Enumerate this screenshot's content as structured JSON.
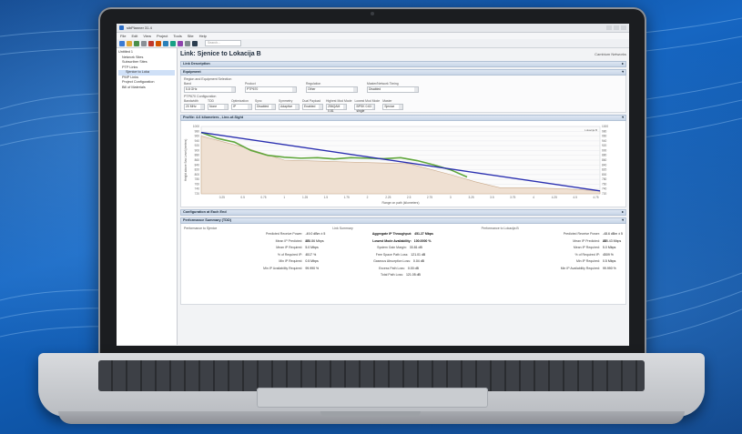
{
  "app": {
    "window_title": "sibPlanner 31.4",
    "menu": [
      "File",
      "Edit",
      "View",
      "Project",
      "Tools",
      "Site",
      "Help"
    ],
    "search_placeholder": "Search...",
    "page_title": "Link: Sjenice to Lokacija B",
    "header_link": "Cambium Networks"
  },
  "tree": [
    {
      "label": "Untitled 1",
      "selected": false
    },
    {
      "label": "Network Sites",
      "selected": false
    },
    {
      "label": "Subscriber Sites",
      "selected": false
    },
    {
      "label": "PTP Links",
      "selected": false
    },
    {
      "label": "Sjenice to Loka",
      "selected": true
    },
    {
      "label": "PMP Links",
      "selected": false
    },
    {
      "label": "Project Configuration",
      "selected": false
    },
    {
      "label": "Bill of Materials",
      "selected": false
    }
  ],
  "sections": {
    "link_description": "Link Description",
    "equipment": "Equipment",
    "profile": "Profile: 4.6 kilometers , Line-of-Sight",
    "configuration": "Configuration at Each End",
    "performance": "Performance Summary (TDD)"
  },
  "equipment": {
    "region_label": "Region and Equipment Selection",
    "fields": [
      {
        "label": "Band",
        "value": "5.8 GHz"
      },
      {
        "label": "Product",
        "value": "PTP670"
      },
      {
        "label": "Regulation",
        "value": "Other"
      },
      {
        "label": "Master/Network Timing",
        "value": "Disabled"
      }
    ],
    "ptp_label": "PTP670 Configuration",
    "config_fields": [
      {
        "label": "Bandwidth",
        "value": "20 MHz"
      },
      {
        "label": "TDD",
        "value": "None"
      },
      {
        "label": "Optimization",
        "value": "IP"
      },
      {
        "label": "Sync",
        "value": "Disabled"
      },
      {
        "label": "Symmetry",
        "value": "Adaptive"
      },
      {
        "label": "Dual Payload",
        "value": "Enabled"
      },
      {
        "label": "Highest Mod Mode",
        "value": "256QAM 0.81"
      },
      {
        "label": "Lowest Mod Mode",
        "value": "BPSK 0.63 single"
      },
      {
        "label": "Master",
        "value": "Sjenice"
      }
    ]
  },
  "chart_data": {
    "type": "line",
    "title": "",
    "xlabel": "Range on path (kilometers)",
    "ylabel": "Height above Sea Level (meters)",
    "x_ticks": [
      "0.25",
      "0.5",
      "0.75",
      "1",
      "1.25",
      "1.5",
      "1.75",
      "2",
      "2.25",
      "2.5",
      "2.75",
      "3",
      "3.25",
      "3.5",
      "3.75",
      "4",
      "4.25",
      "4.5",
      "4.75"
    ],
    "y_ticks_left": [
      "1000",
      "980",
      "960",
      "940",
      "920",
      "900",
      "880",
      "860",
      "840",
      "820",
      "800",
      "780",
      "760",
      "740",
      "720"
    ],
    "y_ticks_right": [
      "1000",
      "980",
      "960",
      "940",
      "920",
      "900",
      "880",
      "860",
      "840",
      "820",
      "800",
      "780",
      "760",
      "740",
      "720"
    ],
    "ylim": [
      720,
      1000
    ],
    "xlim": [
      0,
      4.8
    ],
    "end_label_right": "Lokacija B",
    "series": [
      {
        "name": "",
        "color": "#2a2fb0",
        "x": [
          0,
          4.8
        ],
        "y": [
          975,
          732
        ]
      },
      {
        "name": "",
        "color": "#5fa63a",
        "x": [
          0,
          0.2,
          0.4,
          0.6,
          0.8,
          1.0,
          1.2,
          1.4,
          1.6,
          1.8,
          2.0,
          2.2,
          2.4,
          2.6,
          2.8,
          3.0,
          3.2
        ],
        "y": [
          975,
          950,
          935,
          900,
          880,
          872,
          868,
          870,
          865,
          870,
          868,
          866,
          870,
          858,
          840,
          820,
          790
        ]
      },
      {
        "name": "",
        "color": "#c9a98a",
        "x": [
          0,
          0.5,
          1.0,
          1.5,
          2.0,
          2.5,
          3.0,
          3.3,
          3.6,
          4.0,
          4.4,
          4.8
        ],
        "y": [
          960,
          915,
          860,
          855,
          850,
          845,
          800,
          770,
          745,
          745,
          740,
          732
        ]
      }
    ]
  },
  "performance": {
    "left": {
      "header": "Performance to Sjenice",
      "rows": [
        {
          "k": "Predicted Receive Power:",
          "v": "-49.0 dBm ± 5 dB"
        },
        {
          "k": "Mean IP Predicted:",
          "v": "225.86 Mbps"
        },
        {
          "k": "Mean IP Required:",
          "v": "5.0 Mbps"
        },
        {
          "k": "% of Required IP:",
          "v": "4517 %"
        },
        {
          "k": "Min IP Required:",
          "v": "0.5 Mbps"
        },
        {
          "k": "Min IP Availability Required:",
          "v": "99.990 %"
        }
      ]
    },
    "middle": {
      "header": "Link Summary",
      "rows": [
        {
          "k": "Aggregate IP Throughput:",
          "v": "451.27 Mbps",
          "strong": true
        },
        {
          "k": "Lowest Mode Availability:",
          "v": "100.0000 %",
          "strong": true
        },
        {
          "k": "System Gain Margin:",
          "v": "33.81 dB",
          "strong": false
        },
        {
          "k": "Free Space Path Loss:",
          "v": "121.01 dB",
          "strong": false
        },
        {
          "k": "Gaseous Absorption Loss:",
          "v": "0.04 dB",
          "strong": false
        },
        {
          "k": "Excess Path Loss:",
          "v": "0.00 dB",
          "strong": false
        },
        {
          "k": "Total Path Loss:",
          "v": "121.05 dB",
          "strong": false
        }
      ]
    },
    "right": {
      "header": "Performance to Lokacija B",
      "rows": [
        {
          "k": "Predicted Receive Power:",
          "v": "-48.6 dBm ± 5 dB"
        },
        {
          "k": "Mean IP Predicted:",
          "v": "225.43 Mbps"
        },
        {
          "k": "Mean IP Required:",
          "v": "5.0 Mbps"
        },
        {
          "k": "% of Required IP:",
          "v": "4509 %"
        },
        {
          "k": "Min IP Required:",
          "v": "0.5 Mbps"
        },
        {
          "k": "Min IP Availability Required:",
          "v": "99.990 %"
        }
      ]
    }
  }
}
